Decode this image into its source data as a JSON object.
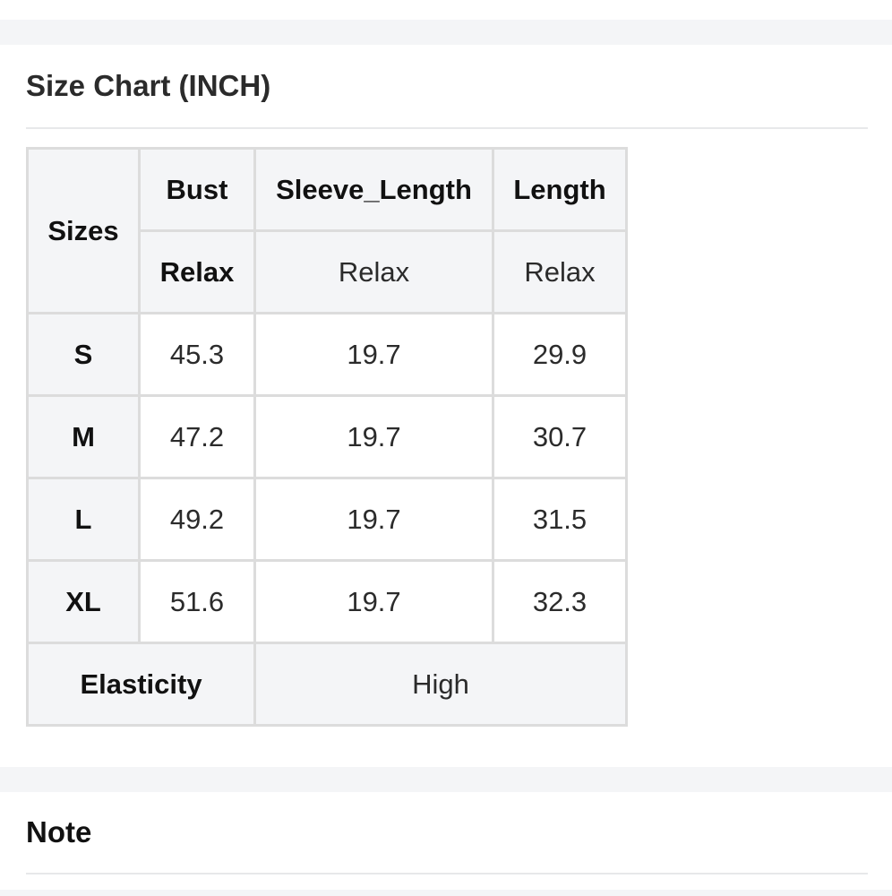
{
  "size_chart": {
    "title": "Size Chart (INCH)",
    "header": {
      "sizes_label": "Sizes",
      "columns": [
        "Bust",
        "Sleeve_Length",
        "Length"
      ],
      "fit": [
        "Relax",
        "Relax",
        "Relax"
      ]
    },
    "rows": [
      {
        "size": "S",
        "bust": "45.3",
        "sleeve_length": "19.7",
        "length": "29.9"
      },
      {
        "size": "M",
        "bust": "47.2",
        "sleeve_length": "19.7",
        "length": "30.7"
      },
      {
        "size": "L",
        "bust": "49.2",
        "sleeve_length": "19.7",
        "length": "31.5"
      },
      {
        "size": "XL",
        "bust": "51.6",
        "sleeve_length": "19.7",
        "length": "32.3"
      }
    ],
    "elasticity": {
      "label": "Elasticity",
      "value": "High"
    }
  },
  "note": {
    "title": "Note"
  },
  "colors": {
    "band_bg": "#f4f5f7",
    "border": "#dcdcdc",
    "text": "#2b2b2b"
  }
}
